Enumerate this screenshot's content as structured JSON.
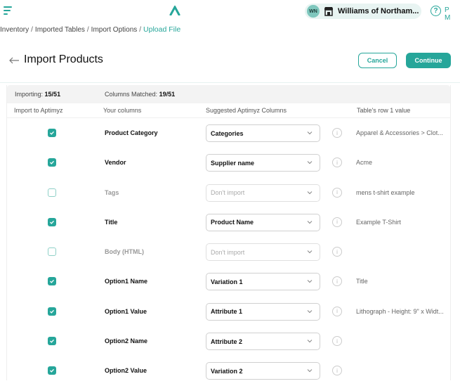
{
  "app": {
    "org_initials": "WN",
    "org_name": "Williams of Northam...",
    "user_initials": "P M",
    "accent_color": "#26a69a"
  },
  "breadcrumb": [
    "Inventory",
    "Imported Tables",
    "Import Options",
    "Upload File"
  ],
  "header": {
    "title": "Import Products",
    "cancel_label": "Cancel",
    "continue_label": "Continue"
  },
  "stats": {
    "importing_label": "Importing:",
    "importing_value": "15/51",
    "matched_label": "Columns Matched:",
    "matched_value": "19/51"
  },
  "columns": [
    "Import to Aptimyz",
    "Your columns",
    "Suggested Aptimyz Columns",
    "Table's row 1 value"
  ],
  "rows": [
    {
      "checked": true,
      "name": "Product Category",
      "suggested": "Categories",
      "sample": "Apparel & Accessories > Clot..."
    },
    {
      "checked": true,
      "name": "Vendor",
      "suggested": "Supplier name",
      "sample": "Acme"
    },
    {
      "checked": false,
      "name": "Tags",
      "suggested": "Don't import",
      "sample": "mens t-shirt example"
    },
    {
      "checked": true,
      "name": "Title",
      "suggested": "Product Name",
      "sample": "Example T-Shirt"
    },
    {
      "checked": false,
      "name": "Body (HTML)",
      "suggested": "Don't import",
      "sample": ""
    },
    {
      "checked": true,
      "name": "Option1 Name",
      "suggested": "Variation 1",
      "sample": "Title"
    },
    {
      "checked": true,
      "name": "Option1 Value",
      "suggested": "Attribute 1",
      "sample": "Lithograph - Height: 9\" x Widt..."
    },
    {
      "checked": true,
      "name": "Option2 Name",
      "suggested": "Attribute 2",
      "sample": ""
    },
    {
      "checked": true,
      "name": "Option2 Value",
      "suggested": "Variation 2",
      "sample": ""
    }
  ]
}
